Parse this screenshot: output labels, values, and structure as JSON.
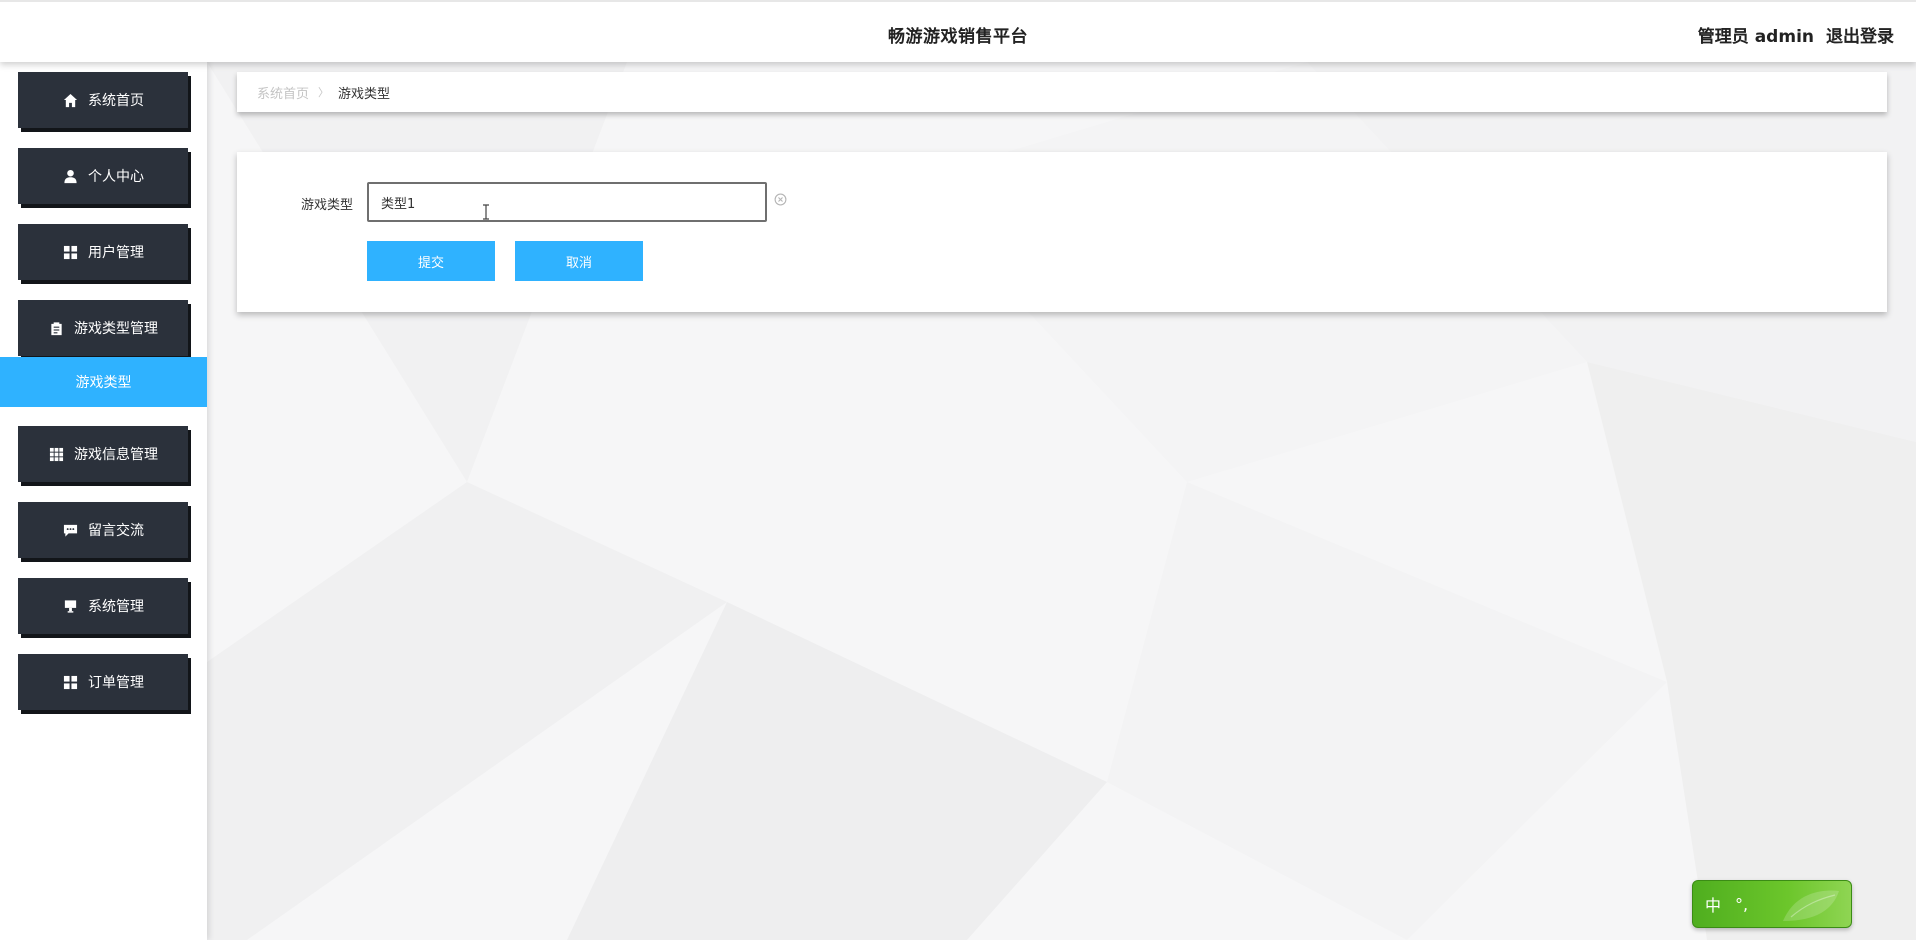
{
  "header": {
    "title": "畅游游戏销售平台",
    "user_label": "管理员 admin",
    "logout_label": "退出登录"
  },
  "sidebar": {
    "items": [
      {
        "label": "系统首页",
        "icon": "home-icon"
      },
      {
        "label": "个人中心",
        "icon": "user-icon"
      },
      {
        "label": "用户管理",
        "icon": "grid-icon"
      },
      {
        "label": "游戏类型管理",
        "icon": "clipboard-icon"
      },
      {
        "label": "游戏信息管理",
        "icon": "table-icon"
      },
      {
        "label": "留言交流",
        "icon": "chat-icon"
      },
      {
        "label": "系统管理",
        "icon": "monitor-icon"
      },
      {
        "label": "订单管理",
        "icon": "grid-icon"
      }
    ],
    "active_subitem": "游戏类型"
  },
  "breadcrumb": {
    "home": "系统首页",
    "separator": "〉",
    "current": "游戏类型"
  },
  "form": {
    "label": "游戏类型",
    "value": "类型1",
    "submit_label": "提交",
    "cancel_label": "取消"
  },
  "ime": {
    "mode": "中",
    "punct": "°,"
  },
  "colors": {
    "accent": "#2fb2ff",
    "sidebar_item": "#2b313b",
    "ime_green": "#5fb828"
  }
}
